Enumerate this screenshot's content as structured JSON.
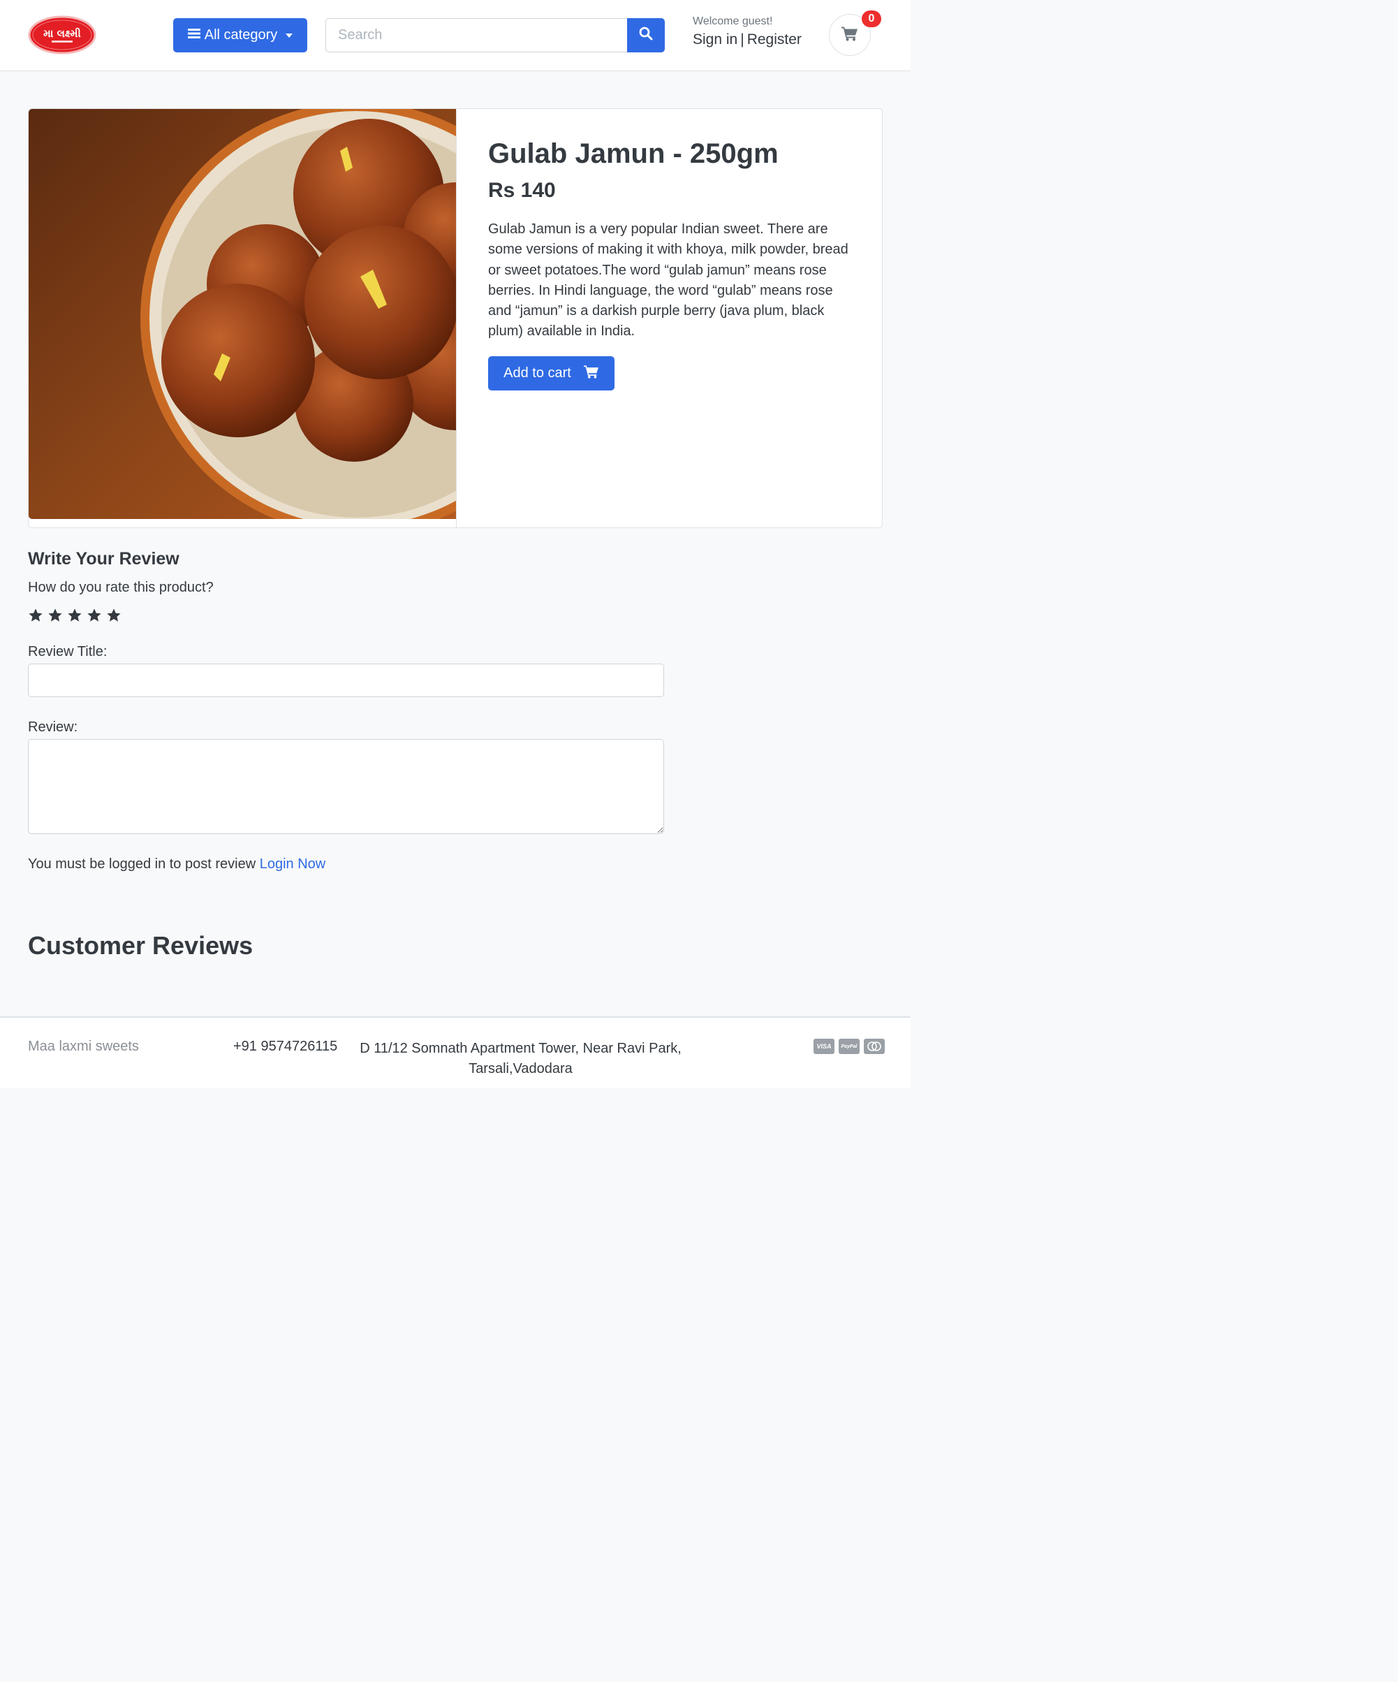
{
  "header": {
    "logo_text": "મા લક્ષ્મી",
    "category_label": "All category",
    "search_placeholder": "Search",
    "welcome": "Welcome guest!",
    "sign_in": "Sign in",
    "separator": "|",
    "register": "Register",
    "cart_count": "0"
  },
  "product": {
    "title": "Gulab Jamun - 250gm",
    "price": "Rs 140",
    "description": "Gulab Jamun is a very popular Indian sweet. There are some versions of making it with khoya, milk powder, bread or sweet potatoes.The word “gulab jamun” means rose berries. In Hindi language, the word “gulab” means rose and “jamun” is a darkish purple berry (java plum, black plum) available in India.",
    "add_to_cart": "Add to cart"
  },
  "review": {
    "heading": "Write Your Review",
    "rate_question": "How do you rate this product?",
    "star_count": 5,
    "title_label": "Review Title:",
    "title_value": "",
    "review_label": "Review:",
    "review_value": "",
    "login_notice": "You must be logged in to post review",
    "login_link": "Login Now"
  },
  "customer_reviews": {
    "heading": "Customer Reviews"
  },
  "footer": {
    "brand": "Maa laxmi sweets",
    "phone": "+91 9574726115",
    "address": "D 11/12 Somnath Apartment Tower, Near Ravi Park, Tarsali,Vadodara",
    "payment_methods": [
      "VISA",
      "PayPal",
      "mastercard"
    ]
  },
  "colors": {
    "accent": "#2f6ae4",
    "badge": "#ee2e2e",
    "text": "#343a40"
  },
  "icons": {
    "menu": "bars-icon",
    "search": "search-icon",
    "cart": "shopping-cart-icon",
    "star": "star-icon"
  }
}
